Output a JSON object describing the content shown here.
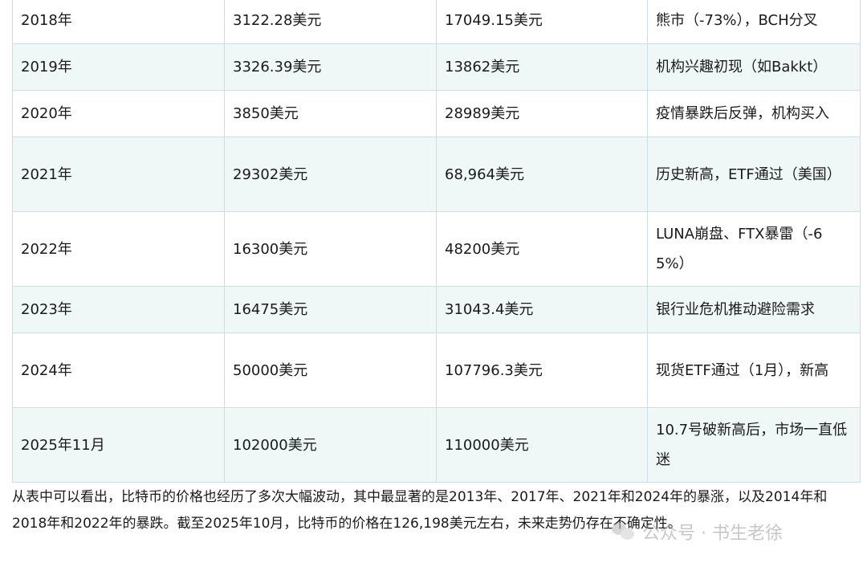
{
  "table": {
    "rows": [
      {
        "year": "2018年",
        "low": "3122.28美元",
        "high": "17049.15美元",
        "note": "熊市（-73%），BCH分叉"
      },
      {
        "year": "2019年",
        "low": "3326.39美元",
        "high": "13862美元",
        "note": "机构兴趣初现（如Bakkt）"
      },
      {
        "year": "2020年",
        "low": "3850美元",
        "high": "28989美元",
        "note": "疫情暴跌后反弹，机构买入"
      },
      {
        "year": "2021年",
        "low": "29302美元",
        "high": "68,964美元",
        "note": "历史新高，ETF通过（美国）"
      },
      {
        "year": "2022年",
        "low": "16300美元",
        "high": "48200美元",
        "note": "LUNA崩盘、FTX暴雷（-65%）"
      },
      {
        "year": "2023年",
        "low": "16475美元",
        "high": "31043.4美元",
        "note": "银行业危机推动避险需求"
      },
      {
        "year": "2024年",
        "low": "50000美元",
        "high": "107796.3美元",
        "note": "现货ETF通过（1月），新高"
      },
      {
        "year": "2025年11月",
        "low": "102000美元",
        "high": "110000美元",
        "note": "10.7号破新高后，市场一直低迷"
      }
    ]
  },
  "paragraph": "从表中可以看出，比特币的价格也经历了多次大幅波动，其中最显著的是2013年、2017年、2021年和2024年的暴涨，以及2014年和2018年和2022年的暴跌。截至2025年10月，比特币的价格在126,198美元左右，未来走势仍存在不确定性。",
  "watermark": {
    "text": "公众号 · 书生老徐",
    "icon": "wechat-icon"
  }
}
